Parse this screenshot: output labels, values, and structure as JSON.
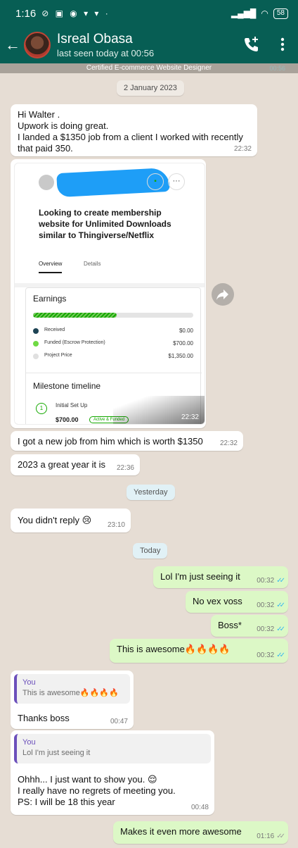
{
  "status_bar": {
    "time": "1:16",
    "notif_icons": "⊘ ▣ ◉ ▾ ▾ ·",
    "battery": "58"
  },
  "header": {
    "contact_name": "Isreal Obasa",
    "last_seen": "last seen today at 00:56",
    "banner_text": "Certified E-commerce Website Designer",
    "banner_faint_time": "00:56"
  },
  "dates": {
    "first": "2 January 2023",
    "yesterday": "Yesterday",
    "today": "Today"
  },
  "messages": [
    {
      "dir": "in",
      "text": "Hi Walter .\nUpwork is doing great.\nI landed a $1350 job from a client I worked with recently\nthat paid 350.",
      "time": "22:32"
    },
    {
      "dir": "in",
      "type": "image",
      "time": "22:32"
    },
    {
      "dir": "in",
      "text": "I got a new job from him which is worth $1350",
      "time": "22:32"
    },
    {
      "dir": "in",
      "text": "2023 a great year it is",
      "time": "22:36"
    },
    {
      "dir": "in",
      "text": "You didn't reply",
      "emoji": "😢",
      "time": "23:10"
    },
    {
      "dir": "out",
      "text": "Lol I'm just seeing it",
      "time": "00:32",
      "ticks": "✓✓"
    },
    {
      "dir": "out",
      "text": "No vex voss",
      "time": "00:32",
      "ticks": "✓✓"
    },
    {
      "dir": "out",
      "text": "Boss*",
      "time": "00:32",
      "ticks": "✓✓"
    },
    {
      "dir": "out",
      "text": "This is awesome",
      "emoji": "🔥🔥🔥🔥",
      "time": "00:32",
      "ticks": "✓✓"
    },
    {
      "dir": "in",
      "quote_name": "You",
      "quote_text": "This is awesome🔥🔥🔥🔥",
      "text": "Thanks boss",
      "time": "00:47"
    },
    {
      "dir": "in",
      "quote_name": "You",
      "quote_text": "Lol I'm just seeing it",
      "text": "Ohhh... I just want to show you. 😌\nI really have no regrets of meeting you.\nPS: I will be 18 this year",
      "time": "00:48"
    },
    {
      "dir": "out",
      "text": "Makes it even more awesome",
      "time": "01:16",
      "ticks": "✓✓"
    }
  ],
  "job_screenshot": {
    "title": "Looking to create membership\nwebsite for Unlimited Downloads\nsimilar to Thingiverse/Netflix",
    "tabs": [
      "Overview",
      "Details"
    ],
    "earnings_heading": "Earnings",
    "funded_fraction": 0.52,
    "rows": [
      {
        "label": "Received",
        "value": "$0.00",
        "color": "#1d4354"
      },
      {
        "label": "Funded (Escrow Protection)",
        "value": "$700.00",
        "color": "#6fda44"
      },
      {
        "label": "Project Price",
        "value": "$1,350.00",
        "color": "#e0e0e0"
      }
    ],
    "milestone_heading": "Milestone timeline",
    "milestone_number": "1",
    "milestone_name": "Initial Set Up",
    "milestone_amount": "$700.00",
    "milestone_badge": "Active & Funded"
  },
  "colors": {
    "header": "#075e54",
    "outgoing": "#dcf8c6",
    "incoming": "#ffffff",
    "tick": "#34b7f1",
    "accent_quote": "#6b4fbb"
  }
}
